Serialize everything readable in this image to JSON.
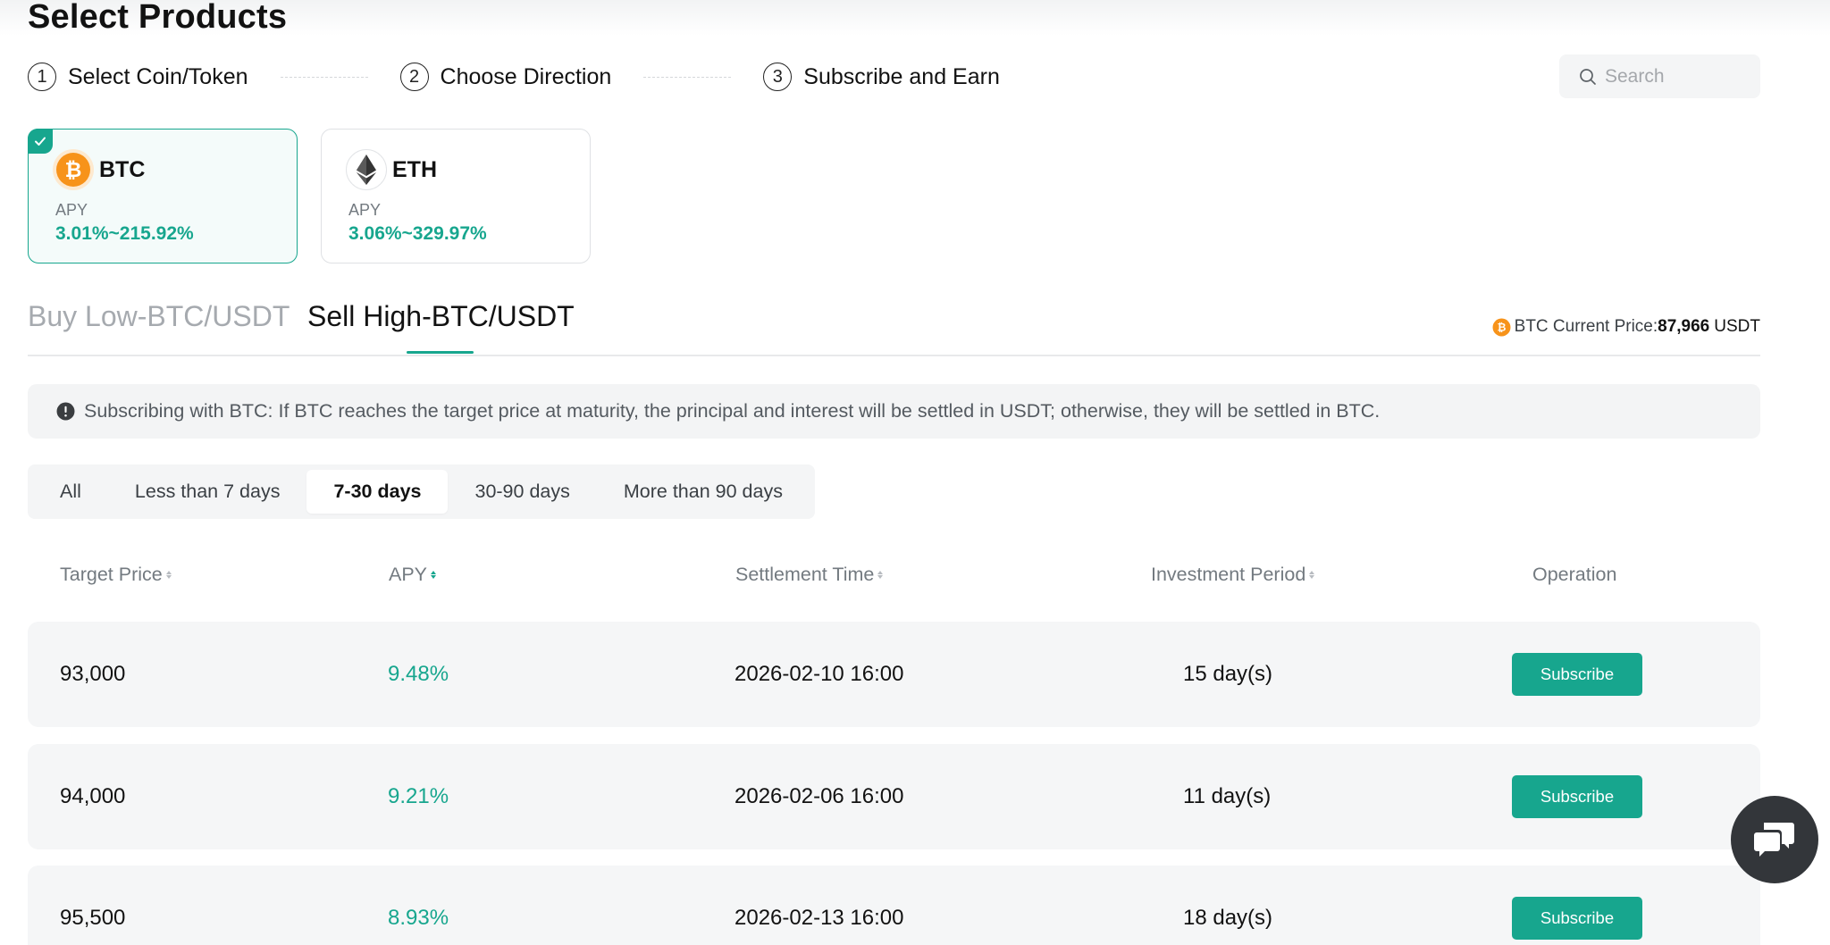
{
  "page": {
    "title": "Select Products"
  },
  "steps": [
    {
      "num": "1",
      "label": "Select Coin/Token"
    },
    {
      "num": "2",
      "label": "Choose Direction"
    },
    {
      "num": "3",
      "label": "Subscribe and Earn"
    }
  ],
  "search": {
    "placeholder": "Search"
  },
  "coins": [
    {
      "symbol": "BTC",
      "apy_label": "APY",
      "apy_range": "3.01%~215.92%",
      "selected": true
    },
    {
      "symbol": "ETH",
      "apy_label": "APY",
      "apy_range": "3.06%~329.97%",
      "selected": false
    }
  ],
  "direction_tabs": [
    {
      "label": "Buy Low-BTC/USDT",
      "active": false
    },
    {
      "label": "Sell High-BTC/USDT",
      "active": true
    }
  ],
  "current_price": {
    "label": "BTC Current Price:",
    "value": "87,966",
    "unit": "USDT"
  },
  "notice": {
    "text": "Subscribing with BTC: If BTC reaches the target price at maturity, the principal and interest will be settled in USDT; otherwise, they will be settled in BTC."
  },
  "duration_filters": [
    {
      "label": "All",
      "active": false
    },
    {
      "label": "Less than 7 days",
      "active": false
    },
    {
      "label": "7-30 days",
      "active": true
    },
    {
      "label": "30-90 days",
      "active": false
    },
    {
      "label": "More than 90 days",
      "active": false
    }
  ],
  "table": {
    "headers": {
      "target_price": "Target Price",
      "apy": "APY",
      "settlement_time": "Settlement Time",
      "investment_period": "Investment Period",
      "operation": "Operation"
    },
    "rows": [
      {
        "target_price": "93,000",
        "apy": "9.48%",
        "settlement_time": "2026-02-10 16:00",
        "investment_period": "15 day(s)",
        "action": "Subscribe"
      },
      {
        "target_price": "94,000",
        "apy": "9.21%",
        "settlement_time": "2026-02-06 16:00",
        "investment_period": "11 day(s)",
        "action": "Subscribe"
      },
      {
        "target_price": "95,500",
        "apy": "8.93%",
        "settlement_time": "2026-02-13 16:00",
        "investment_period": "18 day(s)",
        "action": "Subscribe"
      }
    ]
  },
  "colors": {
    "accent": "#17a68e",
    "btc": "#f7931a",
    "row_bg": "#f5f6f7",
    "chat_button": "#33363a"
  },
  "icons": {
    "search": "search-icon",
    "check": "check-icon",
    "btc": "btc-icon",
    "eth": "eth-icon",
    "info": "info-icon",
    "sort": "sort-icon",
    "chat": "chat-icon"
  }
}
